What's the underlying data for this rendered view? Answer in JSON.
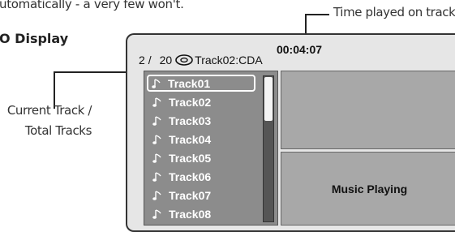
{
  "doc": {
    "intro_text": "utomatically - a very few won't.",
    "heading": "O Display",
    "callout_time": "Time played on track",
    "callout_track_line1": "Current Track /",
    "callout_track_line2": "Total Tracks"
  },
  "screen": {
    "elapsed_time": "00:04:07",
    "current_track": "2",
    "separator": "/",
    "total_tracks": "20",
    "disc_icon": "disc-icon",
    "now_playing_title": "Track02:CDA",
    "status_text": "Music Playing",
    "tracks": [
      {
        "label": "Track01",
        "selected": true
      },
      {
        "label": "Track02",
        "selected": false
      },
      {
        "label": "Track03",
        "selected": false
      },
      {
        "label": "Track04",
        "selected": false
      },
      {
        "label": "Track05",
        "selected": false
      },
      {
        "label": "Track06",
        "selected": false
      },
      {
        "label": "Track07",
        "selected": false
      },
      {
        "label": "Track08",
        "selected": false
      }
    ],
    "track_icon": "music-note-icon",
    "scroll_position": 0.0,
    "colors": {
      "panel_bg": "#e6e6e6",
      "list_bg": "#8c8c8c",
      "box_bg": "#a8a8a8",
      "track_text": "#ffffff"
    }
  }
}
